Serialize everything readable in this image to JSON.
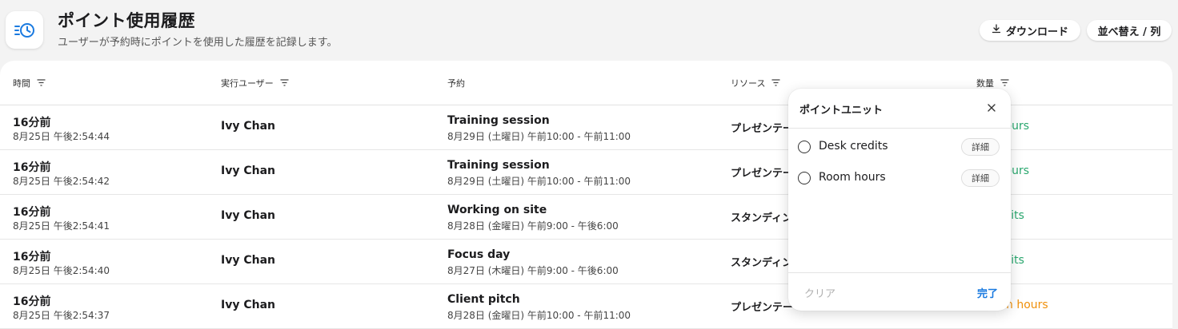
{
  "header": {
    "title": "ポイント使用履歴",
    "subtitle": "ユーザーが予約時にポイントを使用した履歴を記録します。",
    "download_label": "ダウンロード",
    "sort_label": "並べ替え / 列",
    "icon": "history-icon"
  },
  "columns": {
    "time": "時間",
    "user": "実行ユーザー",
    "reservation": "予約",
    "resource": "リソース",
    "quantity": "数量"
  },
  "rows": [
    {
      "time": "16分前",
      "timestamp": "8月25日 午後2:54:44",
      "user": "Ivy Chan",
      "title": "Training session",
      "when": "8月29日 (土曜日) 午前10:00 - 午前11:00",
      "resource": "プレゼンテー",
      "qty": "om hours"
    },
    {
      "time": "16分前",
      "timestamp": "8月25日 午後2:54:42",
      "user": "Ivy Chan",
      "title": "Training session",
      "when": "8月29日 (土曜日) 午前10:00 - 午前11:00",
      "resource": "プレゼンテー",
      "qty": "om hours"
    },
    {
      "time": "16分前",
      "timestamp": "8月25日 午後2:54:41",
      "user": "Ivy Chan",
      "title": "Working on site",
      "when": "8月28日 (金曜日) 午前9:00 - 午後6:00",
      "resource": "スタンディン",
      "qty": "k credits"
    },
    {
      "time": "16分前",
      "timestamp": "8月25日 午後2:54:40",
      "user": "Ivy Chan",
      "title": "Focus day",
      "when": "8月27日 (木曜日) 午前9:00 - 午後6:00",
      "resource": "スタンディン",
      "qty": "k credits"
    },
    {
      "time": "16分前",
      "timestamp": "8月25日 午後2:54:37",
      "user": "Ivy Chan",
      "title": "Client pitch",
      "when": "8月28日 (金曜日) 午前10:00 - 午前11:00",
      "resource": "プレゼンテー",
      "qty": "Room hours"
    }
  ],
  "popup": {
    "title": "ポイントユニット",
    "options": [
      {
        "label": "Desk credits",
        "detail": "詳細"
      },
      {
        "label": "Room hours",
        "detail": "詳細"
      }
    ],
    "clear_label": "クリア",
    "done_label": "完了"
  },
  "colors": {
    "green": "#2aa86f",
    "orange": "#f0900a",
    "accent": "#1a7ae0"
  }
}
